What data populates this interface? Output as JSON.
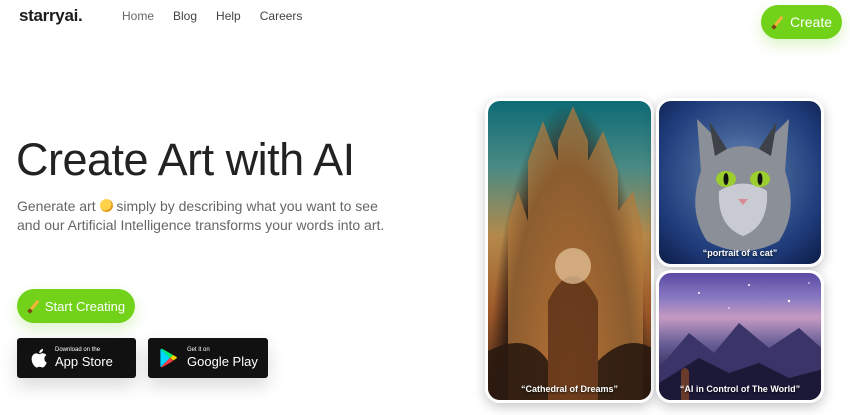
{
  "brand": {
    "name": "starryai."
  },
  "nav": {
    "items": [
      "Home",
      "Blog",
      "Help",
      "Careers"
    ]
  },
  "header": {
    "create_label": "Create"
  },
  "hero": {
    "title": "Create Art with AI",
    "subtitle_before": "Generate art ",
    "subtitle_after": " simply by describing what you want to see and our Artificial Intelligence transforms your words into art.",
    "cta_label": "Start Creating"
  },
  "stores": {
    "apple": {
      "small": "Download on the",
      "big": "App Store"
    },
    "google": {
      "small": "Get it on",
      "big": "Google Play"
    }
  },
  "gallery": [
    {
      "caption": "“Cathedral of Dreams”"
    },
    {
      "caption": "“portrait of a cat”"
    },
    {
      "caption": "“AI in Control of The World”"
    }
  ],
  "colors": {
    "accent": "#72d21a",
    "store_bg": "#111111",
    "title": "#222222",
    "subtitle": "#666666"
  },
  "icons": {
    "pen": "pencil-icon",
    "apple": "apple-icon",
    "play": "google-play-icon",
    "emoji": "palette-emoji-icon"
  }
}
